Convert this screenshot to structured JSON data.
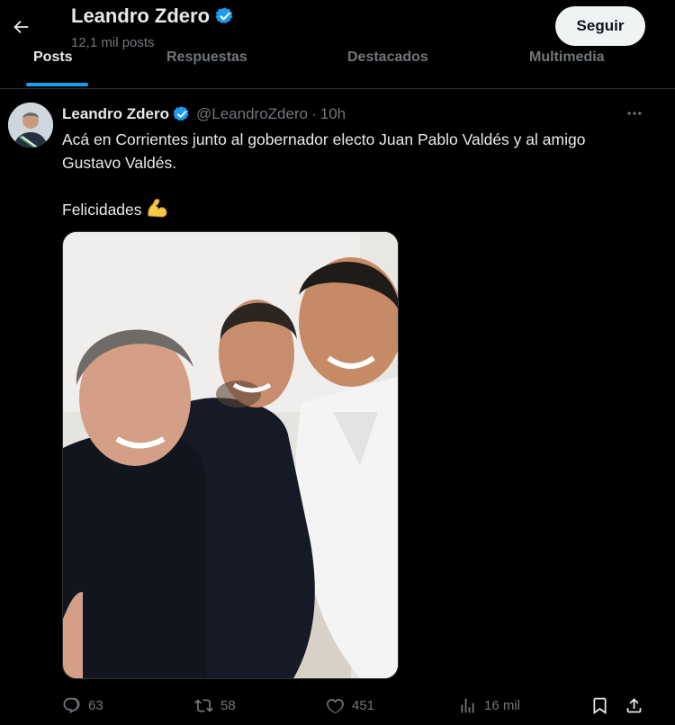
{
  "header": {
    "name": "Leandro Zdero",
    "posts_count": "12,1 mil posts",
    "follow_label": "Seguir"
  },
  "tabs": [
    {
      "label": "Posts",
      "active": true
    },
    {
      "label": "Respuestas",
      "active": false
    },
    {
      "label": "Destacados",
      "active": false
    },
    {
      "label": "Multimedia",
      "active": false
    }
  ],
  "post": {
    "author": "Leandro Zdero",
    "handle": "@LeandroZdero",
    "separator": "·",
    "time": "10h",
    "text_line1": "Acá en Corrientes junto al gobernador electo Juan Pablo Valdés y al amigo Gustavo Valdés.",
    "text_line2": "Felicidades",
    "emoji": "flexed-biceps-emoji",
    "image_subject": "selfie of three smiling men"
  },
  "actions": {
    "replies": "63",
    "reposts": "58",
    "likes": "451",
    "views": "16 mil"
  },
  "colors": {
    "accent": "#1d9bf0",
    "verified": "#1d9bf0",
    "muted": "#71767b",
    "text": "#e7e9ea",
    "background": "#000000"
  }
}
